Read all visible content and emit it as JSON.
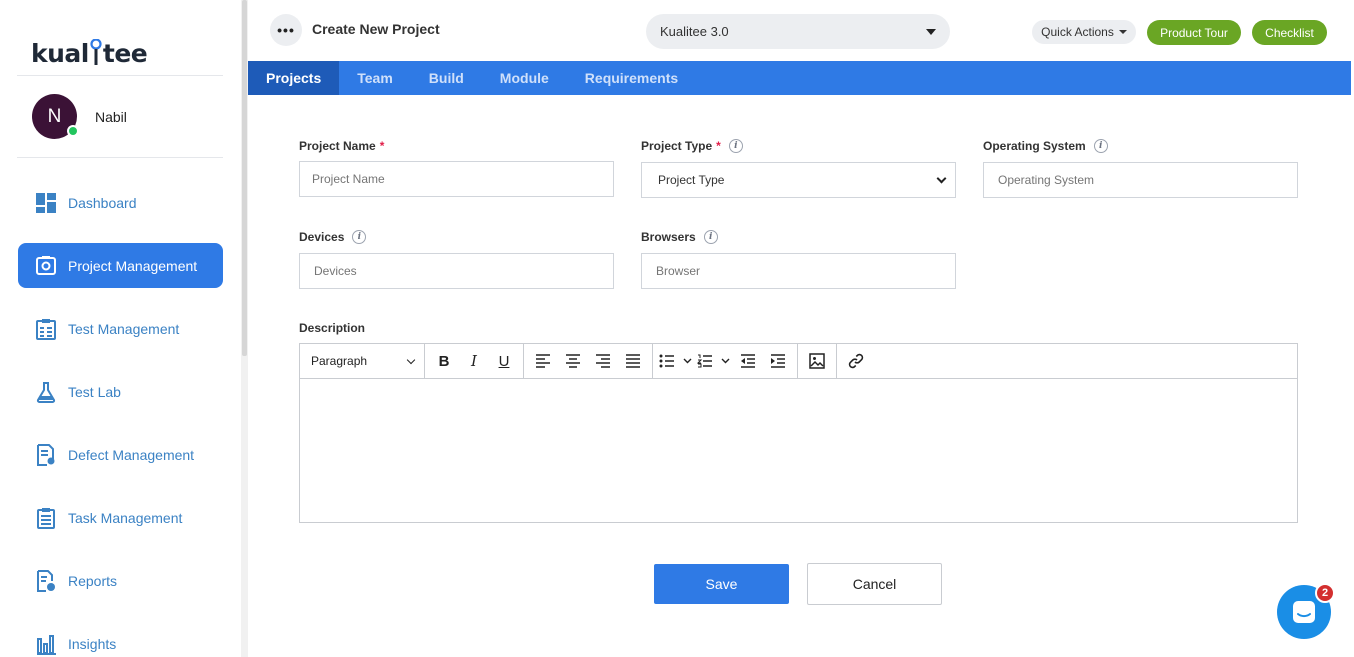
{
  "brand": {
    "logo_text_left": "kual",
    "logo_text_right": "tee",
    "accent": "#2f7ae5",
    "green": "#6aa624"
  },
  "user": {
    "initial": "N",
    "name": "Nabil"
  },
  "sidebar": {
    "items": [
      {
        "label": "Dashboard",
        "icon": "dashboard-icon"
      },
      {
        "label": "Project Management",
        "icon": "project-management-icon",
        "active": true
      },
      {
        "label": "Test Management",
        "icon": "test-management-icon"
      },
      {
        "label": "Test Lab",
        "icon": "flask-icon"
      },
      {
        "label": "Defect Management",
        "icon": "defect-icon"
      },
      {
        "label": "Task Management",
        "icon": "task-icon"
      },
      {
        "label": "Reports",
        "icon": "reports-icon"
      },
      {
        "label": "Insights",
        "icon": "insights-icon"
      }
    ]
  },
  "topbar": {
    "more": "•••",
    "title": "Create New Project",
    "project_selected": "Kualitee 3.0",
    "quick_actions": "Quick Actions",
    "product_tour": "Product Tour",
    "checklist": "Checklist"
  },
  "tabs": [
    {
      "label": "Projects",
      "active": true
    },
    {
      "label": "Team"
    },
    {
      "label": "Build"
    },
    {
      "label": "Module"
    },
    {
      "label": "Requirements"
    }
  ],
  "form": {
    "project_name": {
      "label": "Project Name",
      "required": "*",
      "placeholder": "Project Name"
    },
    "project_type": {
      "label": "Project Type",
      "required": "*",
      "value": "Project Type"
    },
    "operating_system": {
      "label": "Operating System",
      "placeholder": "Operating System"
    },
    "devices": {
      "label": "Devices",
      "placeholder": "Devices"
    },
    "browsers": {
      "label": "Browsers",
      "placeholder": "Browser"
    },
    "description": {
      "label": "Description",
      "block_format": "Paragraph"
    },
    "info_glyph": "i"
  },
  "toolbar_icons": {
    "bold": "B",
    "italic": "I",
    "underline": "U"
  },
  "actions": {
    "save": "Save",
    "cancel": "Cancel"
  },
  "chat": {
    "badge_count": "2"
  }
}
